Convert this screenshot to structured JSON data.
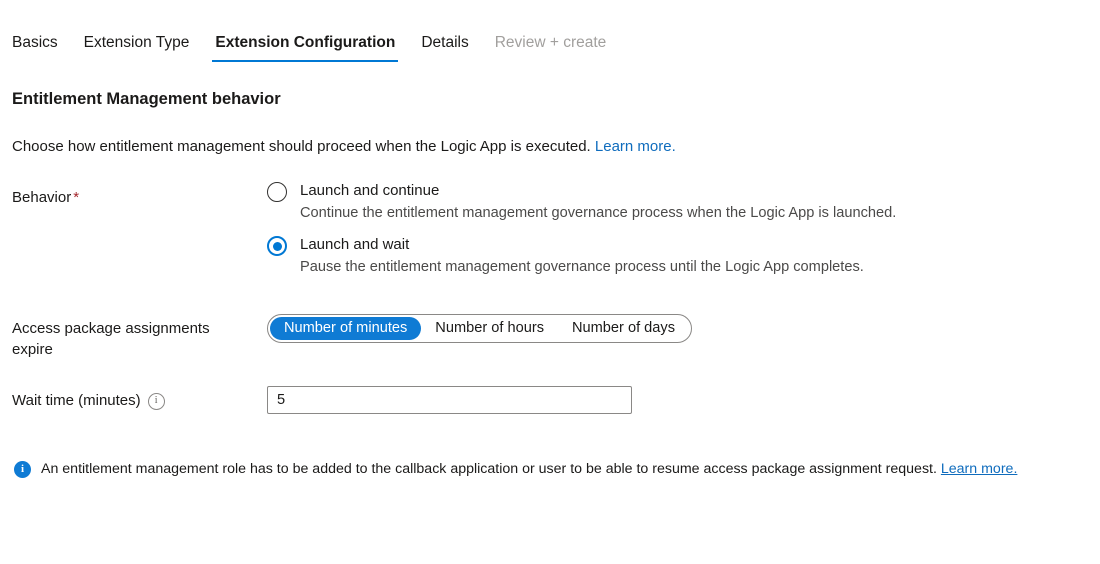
{
  "tabs": [
    {
      "label": "Basics",
      "state": "normal"
    },
    {
      "label": "Extension Type",
      "state": "normal"
    },
    {
      "label": "Extension Configuration",
      "state": "selected"
    },
    {
      "label": "Details",
      "state": "normal"
    },
    {
      "label": "Review + create",
      "state": "disabled"
    }
  ],
  "section": {
    "title": "Entitlement Management behavior",
    "description": "Choose how entitlement management should proceed when the Logic App is executed.",
    "description_link": "Learn more."
  },
  "behavior": {
    "label": "Behavior",
    "required_marker": "*",
    "options": [
      {
        "title": "Launch and continue",
        "description": "Continue the entitlement management governance process when the Logic App is launched.",
        "selected": false
      },
      {
        "title": "Launch and wait",
        "description": "Pause the entitlement management governance process until the Logic App completes.",
        "selected": true
      }
    ]
  },
  "expire": {
    "label": "Access package assignments expire",
    "options": [
      {
        "label": "Number of minutes",
        "selected": true
      },
      {
        "label": "Number of hours",
        "selected": false
      },
      {
        "label": "Number of days",
        "selected": false
      }
    ]
  },
  "wait_time": {
    "label": "Wait time (minutes)",
    "info_icon": "info-circle-outline-icon",
    "value": "5",
    "placeholder": ""
  },
  "info_bar": {
    "icon": "info-circle-filled-icon",
    "text": "An entitlement management role has to be added to the callback application or user to be able to resume access package assignment request.",
    "link": "Learn more."
  },
  "colors": {
    "accent": "#0078d4",
    "link": "#0f6cbd",
    "required": "#a4262c",
    "disabled_text": "#a19f9d",
    "text": "#1b1a19",
    "border": "#8a8886"
  }
}
